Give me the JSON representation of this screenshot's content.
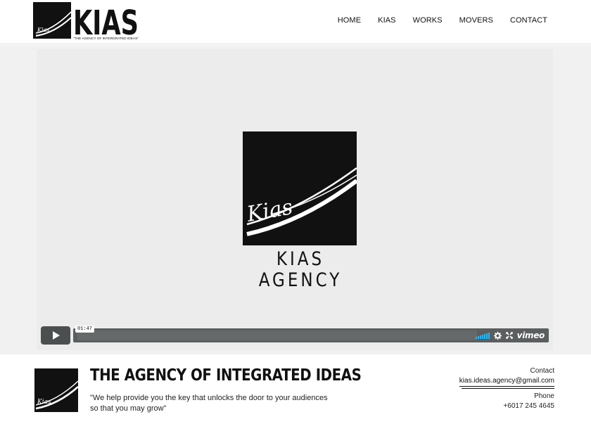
{
  "brand": {
    "wordmark": "KIAS",
    "slogan": "\"THE AGENCY OF INTERGRATED IDEAS\"",
    "script_mark": "Kias"
  },
  "nav": {
    "items": [
      {
        "label": "HOME"
      },
      {
        "label": "KIAS"
      },
      {
        "label": "WORKS"
      },
      {
        "label": "MOVERS"
      },
      {
        "label": "CONTACT"
      }
    ]
  },
  "video": {
    "title": "KIAS AGENCY",
    "time": "01:47",
    "player_brand": "vimeo",
    "icons": [
      "play-icon",
      "volume-icon",
      "settings-icon",
      "fullscreen-icon"
    ]
  },
  "footer": {
    "heading": "THE AGENCY OF INTEGRATED IDEAS",
    "quote": "\"We help provide you the key that unlocks the door to your audiences so that you may grow\"",
    "contact_label": "Contact",
    "email": "kias.ideas.agency@gmail.com",
    "phone_label": "Phone",
    "phone": "+6017 245 4645"
  },
  "colors": {
    "accent": "#29b6f6",
    "control_bar": "#5a5e5e",
    "hero_bg": "#f1f1f1"
  }
}
